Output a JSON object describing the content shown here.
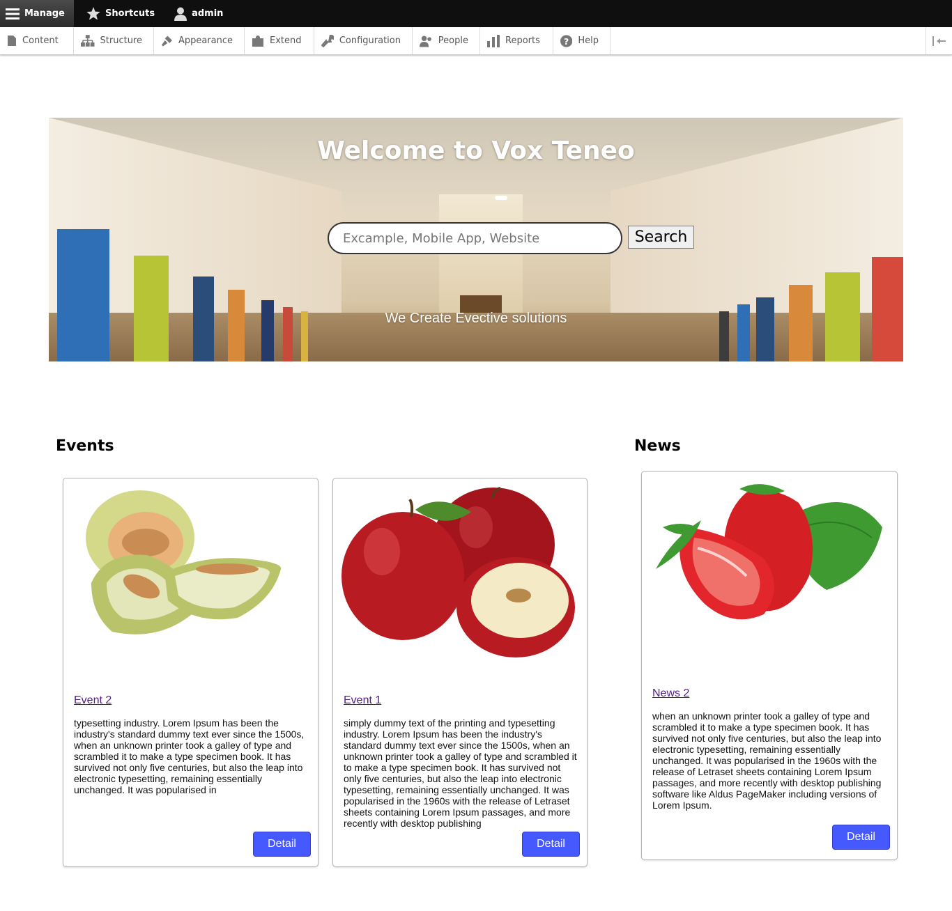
{
  "toolbar": {
    "manage": "Manage",
    "shortcuts": "Shortcuts",
    "user": "admin"
  },
  "tray": {
    "items": [
      "Content",
      "Structure",
      "Appearance",
      "Extend",
      "Configuration",
      "People",
      "Reports",
      "Help"
    ]
  },
  "hero": {
    "title": "Welcome to Vox Teneo",
    "search_placeholder": "Excample, Mobile App, Website",
    "search_button": "Search",
    "tagline": "We Create Evective solutions"
  },
  "events": {
    "heading": "Events",
    "cards": [
      {
        "title": "Event 2",
        "image": "melon",
        "body": "typesetting industry. Lorem Ipsum has been the industry's standard dummy text ever since the 1500s, when an unknown printer took a galley of type and scrambled it to make a type specimen book. It has survived not only five centuries, but also the leap into electronic typesetting, remaining essentially unchanged. It was popularised in",
        "button": "Detail"
      },
      {
        "title": "Event 1",
        "image": "apples",
        "body": "simply dummy text of the printing and typesetting industry. Lorem Ipsum has been the industry's standard dummy text ever since the 1500s, when an unknown printer took a galley of type and scrambled it to make a type specimen book. It has survived not only five centuries, but also the leap into electronic typesetting, remaining essentially unchanged. It was popularised in the 1960s with the release of Letraset sheets containing Lorem Ipsum passages, and more recently with desktop publishing",
        "button": "Detail"
      }
    ]
  },
  "news": {
    "heading": "News",
    "cards": [
      {
        "title": "News 2",
        "image": "strawberries",
        "body": "when an unknown printer took a galley of type and scrambled it to make a type specimen book. It has survived not only five centuries, but also the leap into electronic typesetting, remaining essentially unchanged. It was popularised in the 1960s with the release of Letraset sheets containing Lorem Ipsum passages, and more recently with desktop publishing software like Aldus PageMaker including versions of Lorem Ipsum.",
        "button": "Detail"
      }
    ]
  },
  "colors": {
    "toolbar_bg": "#0f0f0f",
    "detail_button": "#4659ff",
    "link": "#551a8b"
  }
}
